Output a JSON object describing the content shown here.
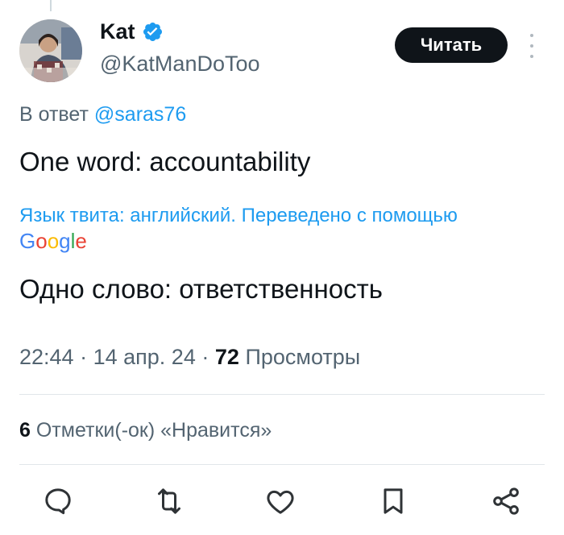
{
  "author": {
    "name": "Kat",
    "handle": "@KatManDoToo",
    "verified_color": "#1d9bf0"
  },
  "header": {
    "follow_label": "Читать"
  },
  "reply": {
    "prefix": "В ответ",
    "mention": "@saras76"
  },
  "tweet": {
    "text": "One word: accountability",
    "translation_note": "Язык твита: английский. Переведено с помощью",
    "translation_provider": "Google",
    "translated_text": "Одно слово: ответственность"
  },
  "meta": {
    "time": "22:44",
    "separator1": "·",
    "date": "14 апр. 24",
    "separator2": "·",
    "views_count": "72",
    "views_label": "Просмотры"
  },
  "likes": {
    "count": "6",
    "label": "Отметки(-ок) «Нравится»"
  },
  "actions": [
    {
      "icon": "reply-icon"
    },
    {
      "icon": "retweet-icon"
    },
    {
      "icon": "like-icon"
    },
    {
      "icon": "bookmark-icon"
    },
    {
      "icon": "share-icon"
    }
  ],
  "colors": {
    "accent": "#1d9bf0",
    "text": "#0f1419",
    "secondary": "#536471"
  }
}
